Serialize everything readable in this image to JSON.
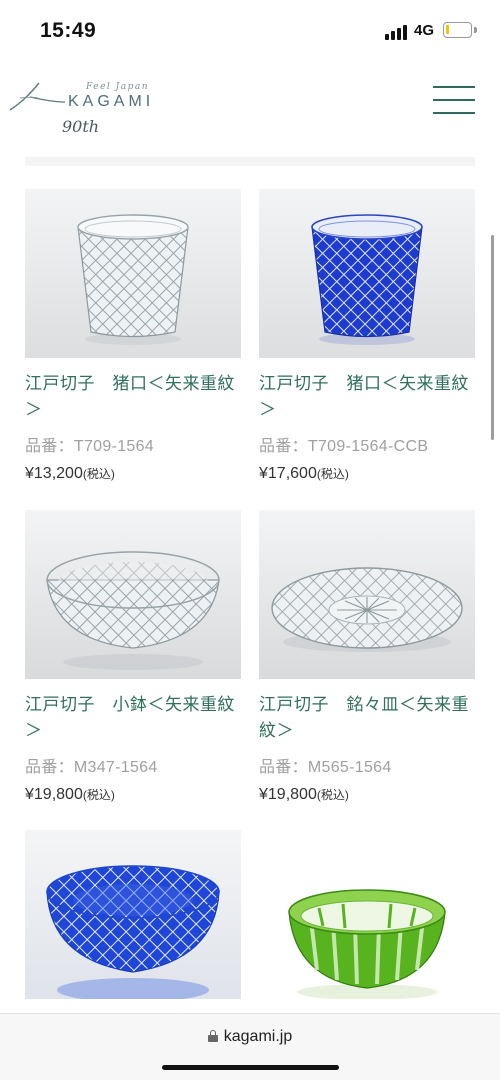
{
  "status_bar": {
    "time": "15:49",
    "network": "4G",
    "battery_level": 0.15
  },
  "header": {
    "logo_tagline": "Feel Japan",
    "logo_name": "KAGAMI",
    "logo_anniversary": "90th",
    "menu_icon": "hamburger-menu-icon"
  },
  "products": [
    {
      "name": "江戸切子　猪口＜矢来重紋＞",
      "code": "品番：T709-1564",
      "price": "¥13,200",
      "tax": "(税込)",
      "glass_color": "#c9d3d8"
    },
    {
      "name": "江戸切子　猪口＜矢来重紋＞",
      "code": "品番：T709-1564-CCB",
      "price": "¥17,600",
      "tax": "(税込)",
      "glass_color": "#1d3ccf"
    },
    {
      "name": "江戸切子　小鉢＜矢来重紋＞",
      "code": "品番：M347-1564",
      "price": "¥19,800",
      "tax": "(税込)",
      "glass_color": "#c9d3d8"
    },
    {
      "name": "江戸切子　銘々皿＜矢来重紋＞",
      "code": "品番：M565-1564",
      "price": "¥19,800",
      "tax": "(税込)",
      "glass_color": "#c9d3d8"
    },
    {
      "name": "",
      "code": "",
      "price": "",
      "tax": "",
      "glass_color": "#1e46d8"
    },
    {
      "name": "",
      "code": "",
      "price": "",
      "tax": "",
      "glass_color": "#58b41e"
    }
  ],
  "browser": {
    "url": "kagami.jp"
  },
  "colors": {
    "brand_green": "#2f6f5c",
    "logo_teal": "#4f6f75",
    "cobalt": "#1d3ccf",
    "green_glass": "#58b41e"
  }
}
